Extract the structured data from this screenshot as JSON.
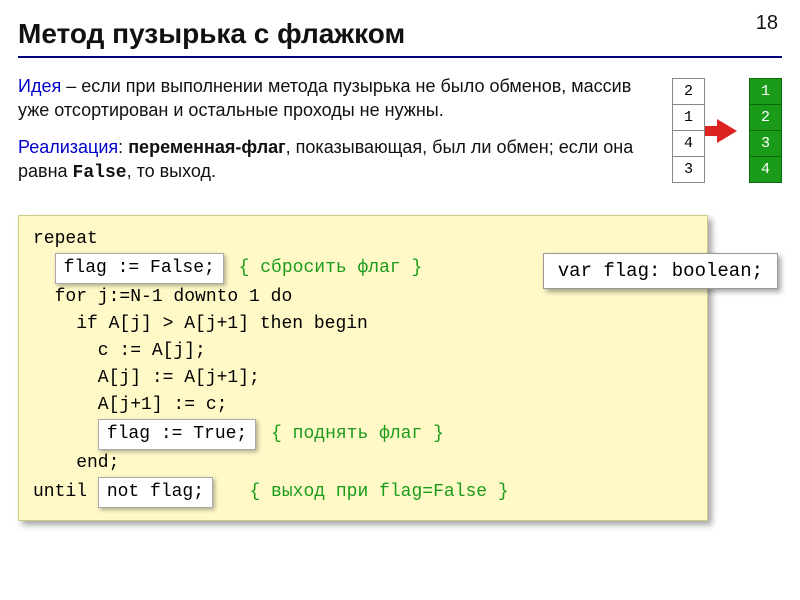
{
  "page_number": "18",
  "title": "Метод пузырька с флажком",
  "para1": {
    "idea_label": "Идея",
    "idea_text": " – если при выполнении метода пузырька не было обменов, массив уже отсортирован и остальные проходы не нужны."
  },
  "para2": {
    "impl_label": "Реализация",
    "impl_mid": ": ",
    "var_flag": "переменная-флаг",
    "impl_text1": ", показывающая, был ли обмен; если она равна ",
    "false_kw": "False",
    "impl_text2": ", то выход."
  },
  "array_left": [
    "2",
    "1",
    "4",
    "3"
  ],
  "array_right": [
    "1",
    "2",
    "3",
    "4"
  ],
  "var_callout": "var flag: boolean;",
  "code": {
    "l1": "repeat",
    "l2_box": "flag := False;",
    "l2_cmt": "{ сбросить флаг }",
    "l3": "  for j:=N-1 downto 1 do",
    "l4": "    if A[j] > A[j+1] then begin",
    "l5": "      c := A[j];",
    "l6": "      A[j] := A[j+1];",
    "l7": "      A[j+1] := c;",
    "l8_box": "flag := True;",
    "l8_cmt": "{ поднять флаг }",
    "l9": "    end;",
    "l10_pre": "until ",
    "l10_box": "not flag;",
    "l10_cmt": "{ выход при flag=False }"
  }
}
